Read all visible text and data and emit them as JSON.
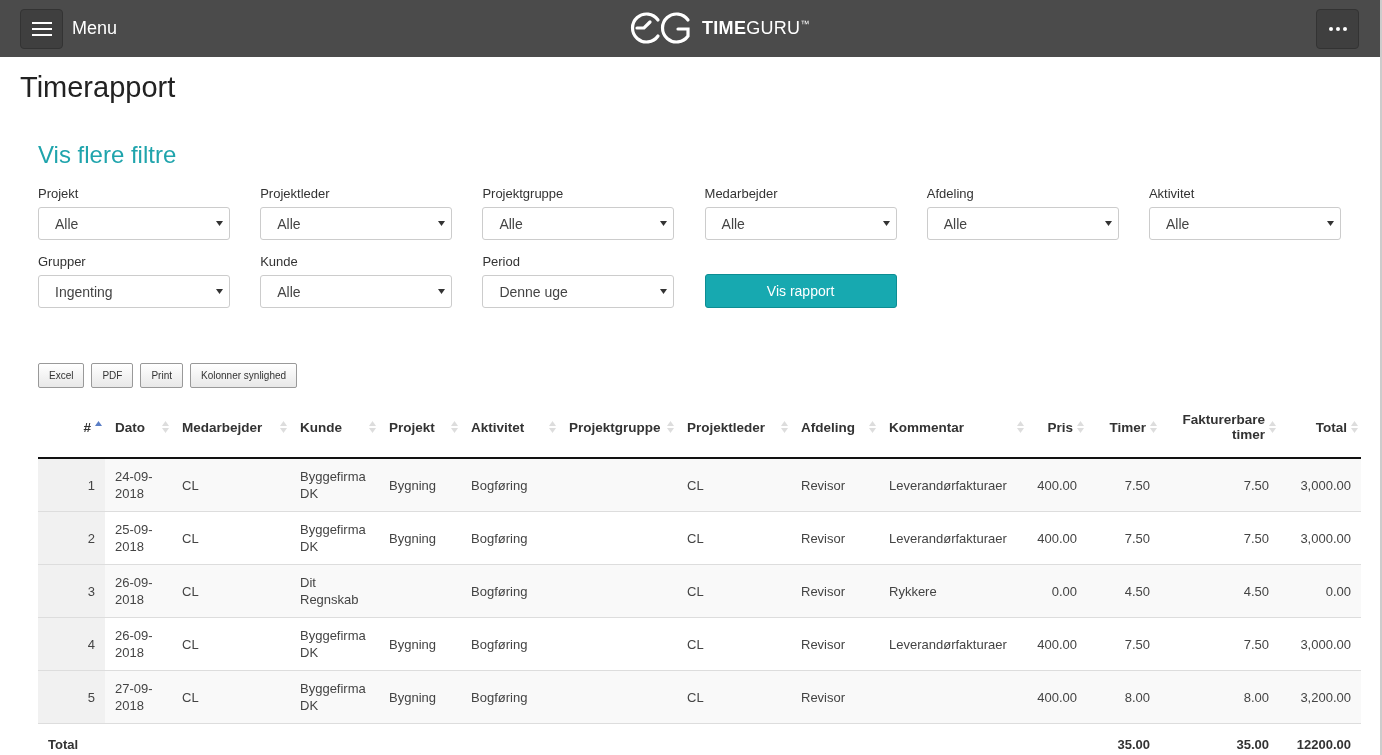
{
  "topbar": {
    "menu_label": "Menu",
    "logo_text": "**TIME**GURU$^{™}$"
  },
  "page_title": "Timerapport",
  "filters_heading": "Vis flere filtre",
  "filters": [
    {
      "label": "Projekt",
      "value": "Alle"
    },
    {
      "label": "Projektleder",
      "value": "Alle"
    },
    {
      "label": "Projektgruppe",
      "value": "Alle"
    },
    {
      "label": "Medarbejder",
      "value": "Alle"
    },
    {
      "label": "Afdeling",
      "value": "Alle"
    },
    {
      "label": "Aktivitet",
      "value": "Alle"
    },
    {
      "label": "Grupper",
      "value": "Ingenting"
    },
    {
      "label": "Kunde",
      "value": "Alle"
    },
    {
      "label": "Period",
      "value": "Denne uge"
    }
  ],
  "report_button": "Vis rapport",
  "export_buttons": [
    "Excel",
    "PDF",
    "Print",
    "Kolonner synlighed"
  ],
  "table": {
    "columns": [
      {
        "label": "#",
        "kind": "number",
        "sorted": true
      },
      {
        "label": "Dato",
        "kind": "text",
        "sorted": false
      },
      {
        "label": "Medarbejder",
        "kind": "text",
        "sorted": false
      },
      {
        "label": "Kunde",
        "kind": "text",
        "sorted": false
      },
      {
        "label": "Projekt",
        "kind": "text",
        "sorted": false
      },
      {
        "label": "Aktivitet",
        "kind": "text",
        "sorted": false
      },
      {
        "label": "Projektgruppe",
        "kind": "text",
        "sorted": false
      },
      {
        "label": "Projektleder",
        "kind": "text",
        "sorted": false
      },
      {
        "label": "Afdeling",
        "kind": "text",
        "sorted": false
      },
      {
        "label": "Kommentar",
        "kind": "text",
        "sorted": false
      },
      {
        "label": "Pris",
        "kind": "number",
        "sorted": false
      },
      {
        "label": "Timer",
        "kind": "number",
        "sorted": false
      },
      {
        "label": "Fakturerbare timer",
        "kind": "number",
        "sorted": false
      },
      {
        "label": "Total",
        "kind": "number",
        "sorted": false
      }
    ],
    "rows": [
      [
        "1",
        "24-09-2018",
        "CL",
        "Byggefirma DK",
        "Bygning",
        "Bogføring",
        "",
        "CL",
        "Revisor",
        "Leverandørfakturaer",
        "400.00",
        "7.50",
        "7.50",
        "3,000.00"
      ],
      [
        "2",
        "25-09-2018",
        "CL",
        "Byggefirma DK",
        "Bygning",
        "Bogføring",
        "",
        "CL",
        "Revisor",
        "Leverandørfakturaer",
        "400.00",
        "7.50",
        "7.50",
        "3,000.00"
      ],
      [
        "3",
        "26-09-2018",
        "CL",
        "Dit Regnskab",
        "",
        "Bogføring",
        "",
        "CL",
        "Revisor",
        "Rykkere",
        "0.00",
        "4.50",
        "4.50",
        "0.00"
      ],
      [
        "4",
        "26-09-2018",
        "CL",
        "Byggefirma DK",
        "Bygning",
        "Bogføring",
        "",
        "CL",
        "Revisor",
        "Leverandørfakturaer",
        "400.00",
        "7.50",
        "7.50",
        "3,000.00"
      ],
      [
        "5",
        "27-09-2018",
        "CL",
        "Byggefirma DK",
        "Bygning",
        "Bogføring",
        "",
        "CL",
        "Revisor",
        "",
        "400.00",
        "8.00",
        "8.00",
        "3,200.00"
      ]
    ],
    "totals": {
      "label": "Total",
      "timer": "35.00",
      "fakturerbare_timer": "35.00",
      "total": "12200.00"
    }
  }
}
